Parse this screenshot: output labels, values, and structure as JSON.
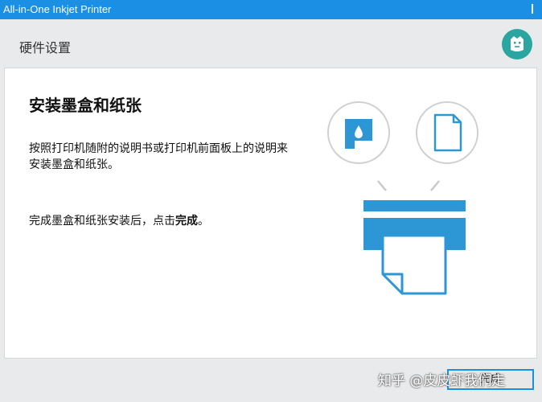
{
  "window": {
    "title": "All-in-One Inkjet Printer"
  },
  "header": {
    "heading": "硬件设置"
  },
  "card": {
    "title": "安装墨盒和纸张",
    "para1": "按照打印机随附的说明书或打印机前面板上的说明来安装墨盒和纸张。",
    "para2_prefix": "完成墨盒和纸张安装后，点击",
    "para2_emphasis": "完成",
    "para2_suffix": "。"
  },
  "footer": {
    "done_button": "完成"
  },
  "watermark": "知乎 @皮皮虾我们走",
  "colors": {
    "titlebar": "#1a8fe3",
    "accent": "#2d96d4",
    "brand": "#2aa5a0",
    "background": "#e9eaec"
  },
  "icons": {
    "ink": "ink-drop-icon",
    "paper": "paper-icon",
    "printer": "printer-icon",
    "brand": "mi-logo-icon"
  }
}
